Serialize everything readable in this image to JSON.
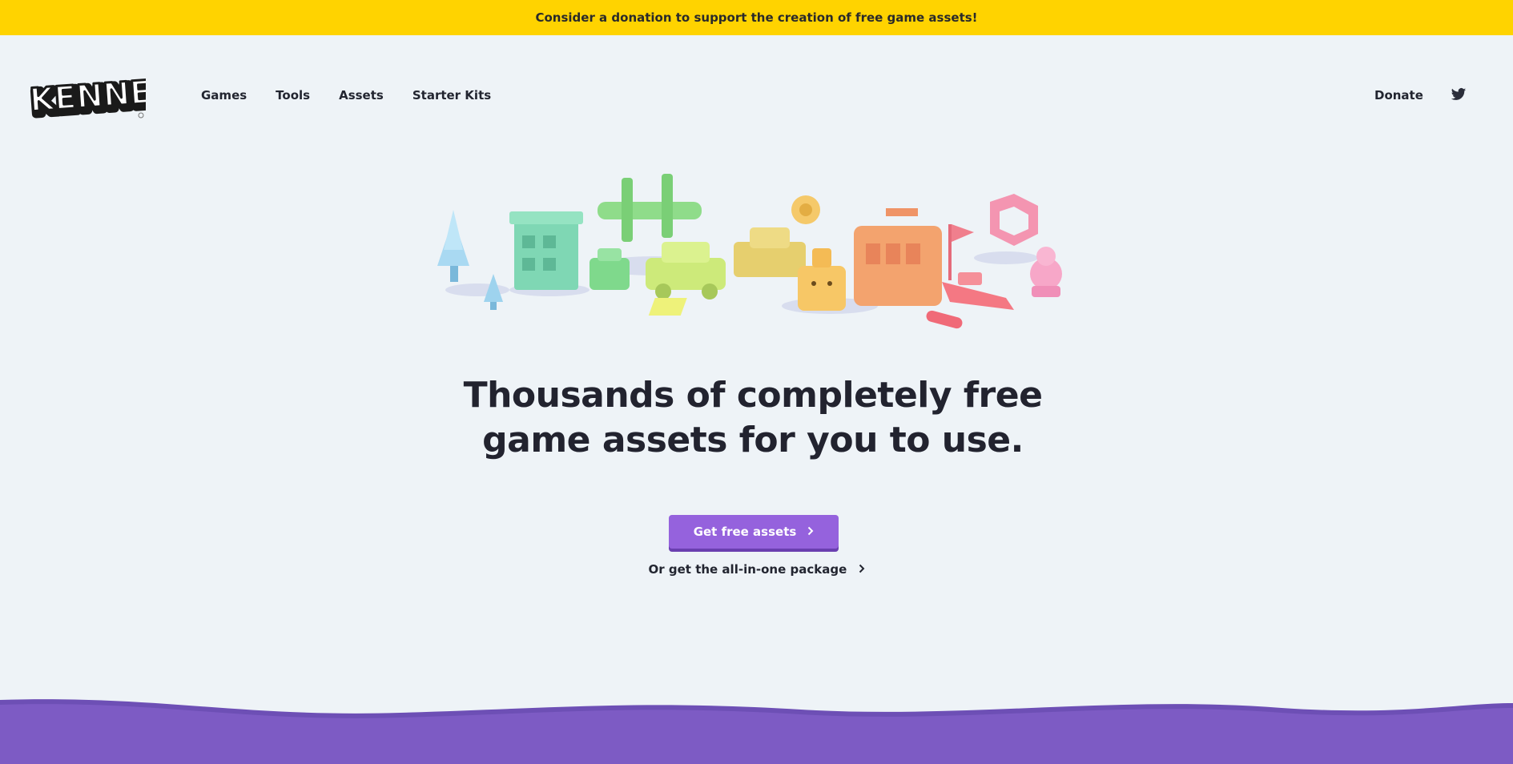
{
  "banner": {
    "text": "Consider a donation to support the creation of free game assets!"
  },
  "logo": {
    "text": "KENNEY"
  },
  "nav": {
    "items": [
      {
        "label": "Games"
      },
      {
        "label": "Tools"
      },
      {
        "label": "Assets"
      },
      {
        "label": "Starter Kits"
      }
    ],
    "donate_label": "Donate",
    "twitter_icon": "twitter-icon"
  },
  "hero": {
    "headline_line1": "Thousands of completely free",
    "headline_line2": "game assets for you to use.",
    "cta_label": "Get free assets",
    "cta_icon": "chevron-right-icon",
    "secondary_label": "Or get the all-in-one package",
    "secondary_icon": "chevron-right-icon"
  },
  "colors": {
    "banner": "#ffd300",
    "background": "#eef3f7",
    "accent": "#9562dd",
    "wave": "#7d5bc4"
  }
}
